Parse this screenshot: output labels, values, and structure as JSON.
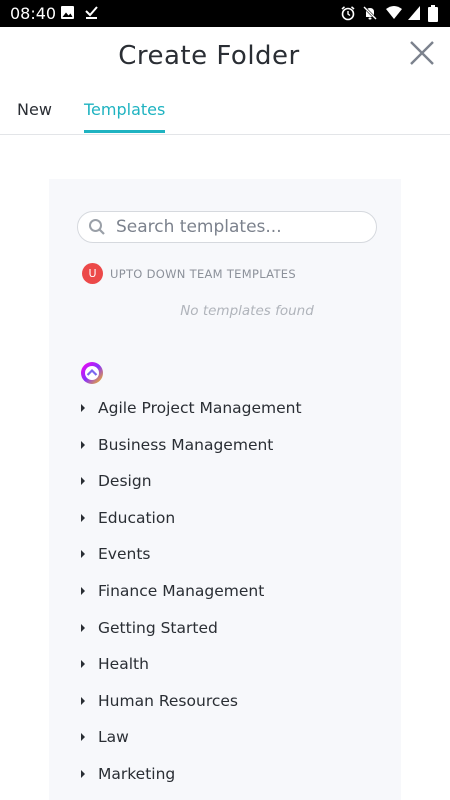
{
  "status_bar": {
    "time": "08:40",
    "left_icons": [
      "image-icon",
      "download-done-icon"
    ],
    "right_icons": [
      "alarm-icon",
      "notifications-off-icon",
      "wifi-icon",
      "cell-signal-icon",
      "battery-icon"
    ]
  },
  "header": {
    "title": "Create Folder",
    "close_icon": "close-icon"
  },
  "tabs": [
    {
      "label": "New",
      "active": false
    },
    {
      "label": "Templates",
      "active": true
    }
  ],
  "search": {
    "placeholder": "Search templates...",
    "value": ""
  },
  "team_templates": {
    "avatar_letter": "U",
    "label": "UPTO DOWN TEAM TEMPLATES",
    "empty_text": "No templates found"
  },
  "categories": [
    "Agile Project Management",
    "Business Management",
    "Design",
    "Education",
    "Events",
    "Finance Management",
    "Getting Started",
    "Health",
    "Human Resources",
    "Law",
    "Marketing"
  ],
  "colors": {
    "accent": "#1fb3c1",
    "text": "#2a2e34",
    "muted": "#8c919a",
    "avatar": "#ec4949",
    "panel_bg": "#f7f8fb"
  }
}
